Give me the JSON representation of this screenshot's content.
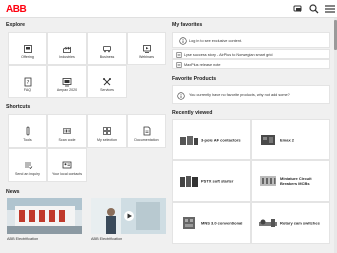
{
  "header": {
    "logo": "ABB",
    "icons": [
      "chat-icon",
      "search-icon",
      "menu-icon"
    ]
  },
  "explore": {
    "title": "Explore",
    "tiles": [
      {
        "label": "Offering",
        "icon": "offering-icon"
      },
      {
        "label": "Industries",
        "icon": "industries-icon"
      },
      {
        "label": "Business",
        "icon": "business-icon"
      },
      {
        "label": "Webinars",
        "icon": "webinars-icon"
      },
      {
        "label": "FAQ",
        "icon": "faq-icon"
      },
      {
        "label": "Ampax 2020",
        "icon": "ampax-icon"
      },
      {
        "label": "Services",
        "icon": "services-icon"
      }
    ]
  },
  "shortcuts": {
    "title": "Shortcuts",
    "tiles": [
      {
        "label": "Tools",
        "icon": "tools-icon"
      },
      {
        "label": "Scan code",
        "icon": "barcode-icon"
      },
      {
        "label": "My selection",
        "icon": "grid-icon"
      },
      {
        "label": "Documentation",
        "icon": "document-icon"
      },
      {
        "label": "Send an inquiry",
        "icon": "inquiry-icon"
      },
      {
        "label": "Your local contacts",
        "icon": "contacts-icon"
      }
    ]
  },
  "news": {
    "title": "News",
    "items": [
      {
        "caption": "ABB Electrification"
      },
      {
        "caption": "ABB Electrification"
      }
    ]
  },
  "favorites": {
    "title": "My favorites",
    "login_text": "Log in to see exclusive content.",
    "rows": [
      {
        "text": "Lyse success story - AirPlus to Norwegian smart grid"
      },
      {
        "text": "MaxPlus release note"
      }
    ]
  },
  "favorite_products": {
    "title": "Favorite Products",
    "empty_text": "You currently have no favorite products, why not add some?"
  },
  "recently_viewed": {
    "title": "Recently viewed",
    "products": [
      {
        "name": "3-pole AF contactors"
      },
      {
        "name": "Emax 2"
      },
      {
        "name": "PSTX soft starter"
      },
      {
        "name": "Miniature Circuit Breakers MCBs"
      },
      {
        "name": "MNS 3.0 conventional"
      },
      {
        "name": "Rotary cam switches"
      }
    ]
  },
  "colors": {
    "brand_red": "#ff000f",
    "background": "#f0f0f0",
    "card": "#ffffff"
  }
}
